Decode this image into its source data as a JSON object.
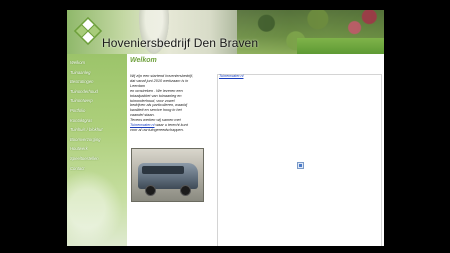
{
  "site": {
    "title": "Hoveniersbedrijf Den Braven"
  },
  "menu": [
    "Welkom",
    "Tuinaanleg",
    "Bestratingen",
    "Tuinonderhoud",
    "Tuinontwerp",
    "Portfolio",
    "Kontaktgras",
    "Tuinhuis / blokhut",
    "Boomverzorging",
    "Houtwerk",
    "Speeltoestellen",
    "Contact"
  ],
  "content": {
    "title": "Welkom",
    "lines": [
      "Wij zijn een startend hoveniersbedrijf,",
      "dat vanaf juni 2010 werkzaam is in",
      "Leerdam",
      "en omstreken . We leveren een",
      "totaalpakket van tuinaanleg en",
      "tuinonderhoud, voor zowel",
      "bedrijven als particulieren, waarbij",
      "kwaliteit en service hoog in het",
      "vaandel staan."
    ],
    "partner_prefix": "Tevens werken wij samen met",
    "partner_link": "Tuinenwater.nl",
    "partner_suffix": "waar u terecht kunt",
    "partner_end": "voor al uw tuingereedschappen.",
    "frame_link": "Tuinenwater.nl"
  },
  "colors": {
    "background": "#000000",
    "accent_green": "#6ea03c",
    "link_blue": "#1a3fbf"
  },
  "icons": {
    "logo": "diamond-leaf-logo",
    "broken_image": "broken-image-icon"
  }
}
